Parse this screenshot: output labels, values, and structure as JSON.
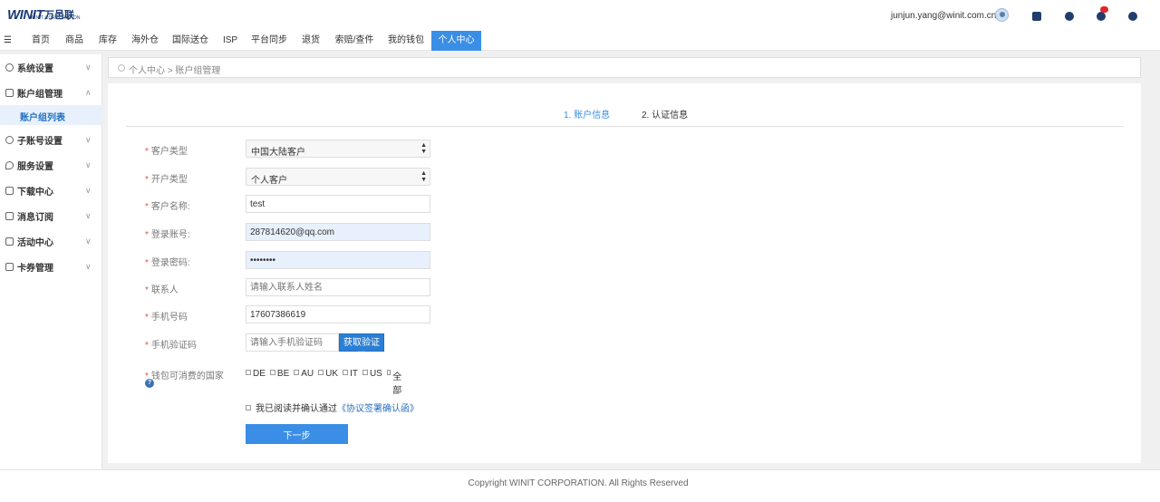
{
  "brand": {
    "logo_text": "WINIT",
    "logo_cn": "万邑联",
    "logo_sub": "WINIT CORPORATION"
  },
  "header": {
    "user_email": "junjun.yang@winit.com.cn",
    "icons": [
      "download-icon",
      "support-icon",
      "message-icon",
      "globe-icon"
    ],
    "accent_color": "#3a8ee6"
  },
  "nav": {
    "menu_icon": "☰",
    "items": [
      {
        "label": "首页"
      },
      {
        "label": "商品"
      },
      {
        "label": "库存"
      },
      {
        "label": "海外仓"
      },
      {
        "label": "国际送仓"
      },
      {
        "label": "ISP"
      },
      {
        "label": "平台同步"
      },
      {
        "label": "退货"
      },
      {
        "label": "索赔/查件"
      },
      {
        "label": "我的钱包"
      },
      {
        "label": "个人中心"
      }
    ],
    "active": "个人中心"
  },
  "sidebar": {
    "items": [
      {
        "label": "系统设置",
        "chevron": "∨"
      },
      {
        "label": "账户组管理",
        "chevron": "∧"
      },
      {
        "label": "子账号设置",
        "chevron": "∨"
      },
      {
        "label": "服务设置",
        "chevron": "∨"
      },
      {
        "label": "下载中心",
        "chevron": "∨"
      },
      {
        "label": "消息订阅",
        "chevron": "∨"
      },
      {
        "label": "活动中心",
        "chevron": "∨"
      },
      {
        "label": "卡券管理",
        "chevron": "∨"
      }
    ],
    "sub_item": "账户组列表"
  },
  "breadcrumb": "个人中心 > 账户组管理",
  "steps": {
    "step1": "1. 账户信息",
    "step2": "2. 认证信息"
  },
  "form": {
    "required_mark": "*",
    "customer_type": {
      "label": "客户类型",
      "value": "中国大陆客户"
    },
    "account_type": {
      "label": "开户类型",
      "value": "个人客户"
    },
    "customer_name": {
      "label": "客户名称:",
      "value": "test"
    },
    "login_account": {
      "label": "登录账号:",
      "value": "287814620@qq.com"
    },
    "login_password": {
      "label": "登录密码:",
      "value": "••••••••"
    },
    "contact": {
      "label": "联系人",
      "placeholder": "请输入联系人姓名"
    },
    "phone": {
      "label": "手机号码",
      "value": "17607386619"
    },
    "sms_code": {
      "label": "手机验证码",
      "placeholder": "请输入手机验证码",
      "button": "获取验证码"
    },
    "wallet_countries": {
      "label": "钱包可消费的国家",
      "help": "?",
      "options": [
        "DE",
        "BE",
        "AU",
        "UK",
        "IT",
        "US",
        "全部"
      ]
    },
    "agree": {
      "text": "我已阅读并确认通过",
      "link": "《协议签署确认函》"
    },
    "next_button": "下一步"
  },
  "footer": "Copyright WINIT CORPORATION. All Rights Reserved"
}
